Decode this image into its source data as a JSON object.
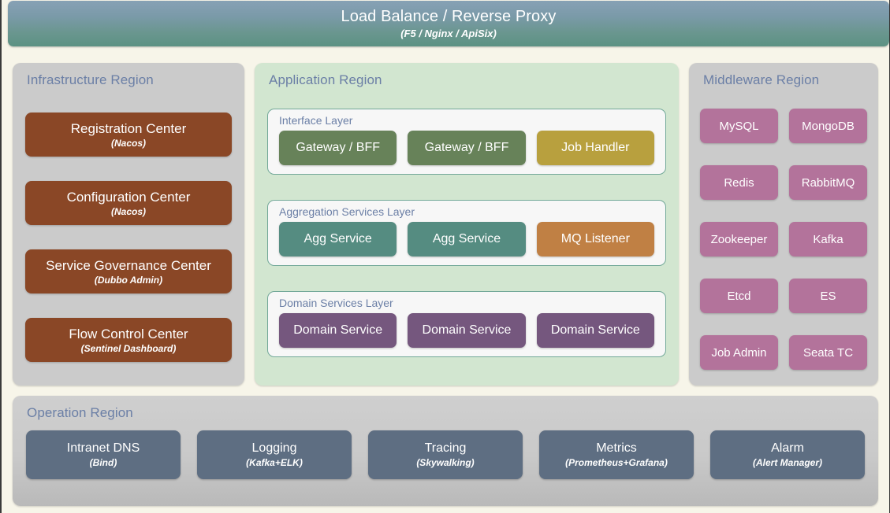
{
  "banner": {
    "title": "Load Balance / Reverse Proxy",
    "subtitle": "(F5 / Nginx / ApiSix)",
    "gradient_from": "#87a1b5",
    "gradient_to": "#5c9283"
  },
  "page": {
    "background": "#f7f5e9",
    "region_title_color": "#6b7fa6"
  },
  "infrastructure": {
    "title": "Infrastructure Region",
    "background": "#cbcbcb",
    "node_color": "#8a4726",
    "nodes": [
      {
        "label": "Registration Center",
        "sub": "(Nacos)"
      },
      {
        "label": "Configuration Center",
        "sub": "(Nacos)"
      },
      {
        "label": "Service Governance Center",
        "sub": "(Dubbo Admin)"
      },
      {
        "label": "Flow Control Center",
        "sub": "(Sentinel Dashboard)"
      }
    ]
  },
  "application": {
    "title": "Application Region",
    "background": "#d2e6d0",
    "layer_background": "#f7f7f7",
    "layer_border": "#72a898",
    "layers": [
      {
        "title": "Interface Layer",
        "nodes": [
          {
            "label": "Gateway / BFF",
            "color": "#678259"
          },
          {
            "label": "Gateway / BFF",
            "color": "#678259"
          },
          {
            "label": "Job Handler",
            "color": "#b8a03e"
          }
        ]
      },
      {
        "title": "Aggregation Services Layer",
        "nodes": [
          {
            "label": "Agg Service",
            "color": "#558c81"
          },
          {
            "label": "Agg Service",
            "color": "#558c81"
          },
          {
            "label": "MQ Listener",
            "color": "#c08044"
          }
        ]
      },
      {
        "title": "Domain Services Layer",
        "nodes": [
          {
            "label": "Domain Service",
            "color": "#75577e"
          },
          {
            "label": "Domain Service",
            "color": "#75577e"
          },
          {
            "label": "Domain Service",
            "color": "#75577e"
          }
        ]
      }
    ]
  },
  "middleware": {
    "title": "Middleware Region",
    "background": "#cbcbcb",
    "node_color": "#b3739b",
    "nodes": [
      "MySQL",
      "MongoDB",
      "Redis",
      "RabbitMQ",
      "Zookeeper",
      "Kafka",
      "Etcd",
      "ES",
      "Job Admin",
      "Seata TC"
    ]
  },
  "operation": {
    "title": "Operation Region",
    "background": "#cbcbcb",
    "node_color": "#5e6e82",
    "nodes": [
      {
        "label": "Intranet DNS",
        "sub": "(Bind)"
      },
      {
        "label": "Logging",
        "sub": "(Kafka+ELK)"
      },
      {
        "label": "Tracing",
        "sub": "(Skywalking)"
      },
      {
        "label": "Metrics",
        "sub": "(Prometheus+Grafana)"
      },
      {
        "label": "Alarm",
        "sub": "(Alert Manager)"
      }
    ]
  }
}
